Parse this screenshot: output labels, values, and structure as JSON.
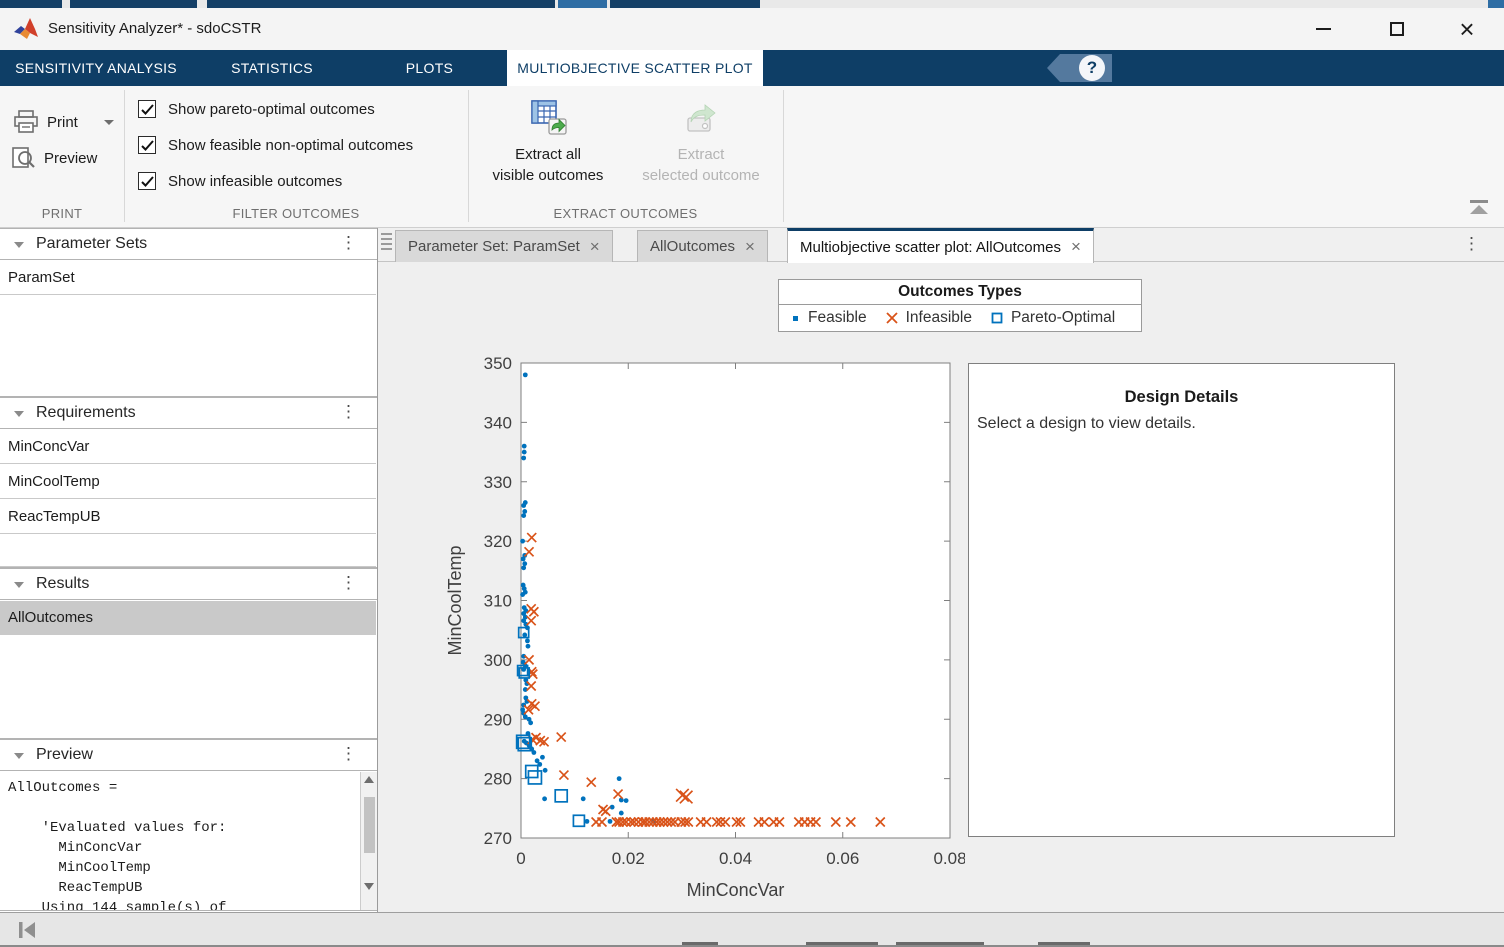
{
  "window": {
    "title": "Sensitivity Analyzer* - sdoCSTR"
  },
  "ribbon": {
    "tabs": [
      {
        "label": "SENSITIVITY ANALYSIS",
        "active": false
      },
      {
        "label": "STATISTICS",
        "active": false
      },
      {
        "label": "PLOTS",
        "active": false
      },
      {
        "label": "MULTIOBJECTIVE SCATTER PLOT",
        "active": true
      }
    ],
    "print_section": {
      "label": "PRINT",
      "print_button": "Print",
      "preview_button": "Preview"
    },
    "filter_section": {
      "label": "FILTER OUTCOMES",
      "checkboxes": [
        {
          "label": "Show pareto-optimal outcomes",
          "checked": true
        },
        {
          "label": "Show feasible non-optimal outcomes",
          "checked": true
        },
        {
          "label": "Show infeasible outcomes",
          "checked": true
        }
      ]
    },
    "extract_section": {
      "label": "EXTRACT OUTCOMES",
      "extract_all_line1": "Extract all",
      "extract_all_line2": "visible outcomes",
      "extract_selected_line1": "Extract",
      "extract_selected_line2": "selected outcome"
    }
  },
  "sidebar": {
    "parameter_sets": {
      "title": "Parameter Sets",
      "items": [
        "ParamSet"
      ]
    },
    "requirements": {
      "title": "Requirements",
      "items": [
        "MinConcVar",
        "MinCoolTemp",
        "ReacTempUB"
      ]
    },
    "results": {
      "title": "Results",
      "items": [
        "AllOutcomes"
      ],
      "selected": "AllOutcomes"
    },
    "preview": {
      "title": "Preview",
      "text": "AllOutcomes =\n\n    'Evaluated values for:\n      MinConcVar\n      MinCoolTemp\n      ReacTempUB\n    Using 144 sample(s) of"
    }
  },
  "doc_tabs": [
    {
      "label": "Parameter Set: ParamSet",
      "active": false
    },
    {
      "label": "AllOutcomes",
      "active": false
    },
    {
      "label": "Multiobjective scatter plot: AllOutcomes",
      "active": true
    }
  ],
  "design_details": {
    "title": "Design Details",
    "body": "Select a design to view details."
  },
  "chart_data": {
    "type": "scatter",
    "xlabel": "MinConcVar",
    "ylabel": "MinCoolTemp",
    "xlim": [
      0,
      0.08
    ],
    "ylim": [
      270,
      350
    ],
    "xticks": [
      0,
      0.02,
      0.04,
      0.06,
      0.08
    ],
    "xtick_labels": [
      "0",
      "0.02",
      "0.04",
      "0.06",
      "0.08"
    ],
    "yticks": [
      270,
      280,
      290,
      300,
      310,
      320,
      330,
      340,
      350
    ],
    "legend": {
      "title": "Outcomes Types",
      "position": "top",
      "entries": [
        {
          "label": "Feasible",
          "marker": "dot",
          "color": "#0072BD"
        },
        {
          "label": "Infeasible",
          "marker": "x",
          "color": "#D95319"
        },
        {
          "label": "Pareto-Optimal",
          "marker": "square-open",
          "color": "#0072BD"
        }
      ]
    },
    "series": [
      {
        "name": "Feasible",
        "marker": "dot",
        "color": "#0072BD",
        "points": [
          [
            0.0008,
            348
          ],
          [
            0.0006,
            336
          ],
          [
            0.0006,
            335
          ],
          [
            0.0005,
            334
          ],
          [
            0.0008,
            326.5
          ],
          [
            0.0005,
            326
          ],
          [
            0.0007,
            325
          ],
          [
            0.0005,
            324.3
          ],
          [
            0.0003,
            320
          ],
          [
            0.0007,
            317.6
          ],
          [
            0.0004,
            317
          ],
          [
            0.0007,
            316.2
          ],
          [
            0.0005,
            315.5
          ],
          [
            0.0004,
            312.6
          ],
          [
            0.0006,
            312
          ],
          [
            0.0008,
            311.4
          ],
          [
            0.0003,
            311
          ],
          [
            0.0006,
            308.8
          ],
          [
            0.0009,
            308.3
          ],
          [
            0.0005,
            307.8
          ],
          [
            0.0008,
            307.2
          ],
          [
            0.0005,
            306.6
          ],
          [
            0.0009,
            306
          ],
          [
            0.0012,
            305.4
          ],
          [
            0.0007,
            304.2
          ],
          [
            0.0012,
            303.2
          ],
          [
            0.0013,
            302.3
          ],
          [
            0.0005,
            300.6
          ],
          [
            0.0004,
            299.6
          ],
          [
            0.0008,
            299
          ],
          [
            0.0005,
            298.4
          ],
          [
            0.0009,
            296.6
          ],
          [
            0.0011,
            296
          ],
          [
            0.0008,
            295
          ],
          [
            0.0009,
            293.6
          ],
          [
            0.0011,
            293
          ],
          [
            0.0005,
            292.4
          ],
          [
            0.0003,
            291.6
          ],
          [
            0.0005,
            291
          ],
          [
            0.0008,
            290.4
          ],
          [
            0.0015,
            290
          ],
          [
            0.0018,
            289.4
          ],
          [
            0.0013,
            287.6
          ],
          [
            0.0006,
            286.3
          ],
          [
            0.001,
            286
          ],
          [
            0.0015,
            285.6
          ],
          [
            0.002,
            285
          ],
          [
            0.0024,
            284.4
          ],
          [
            0.004,
            283.6
          ],
          [
            0.003,
            283
          ],
          [
            0.0035,
            282.4
          ],
          [
            0.0045,
            281.4
          ],
          [
            0.0044,
            276.6
          ],
          [
            0.0116,
            276.6
          ],
          [
            0.0183,
            280
          ],
          [
            0.0187,
            276.4
          ],
          [
            0.0196,
            276.3
          ],
          [
            0.017,
            275.2
          ],
          [
            0.0187,
            274.2
          ],
          [
            0.0123,
            272.8
          ],
          [
            0.0166,
            272.8
          ],
          [
            0.0247,
            272.8
          ]
        ]
      },
      {
        "name": "Infeasible",
        "marker": "x",
        "color": "#D95319",
        "points": [
          [
            0.002,
            320.6
          ],
          [
            0.0015,
            318.2
          ],
          [
            0.0019,
            308.6
          ],
          [
            0.0024,
            308.1
          ],
          [
            0.0019,
            306.6
          ],
          [
            0.0015,
            300
          ],
          [
            0.002,
            298
          ],
          [
            0.0022,
            297.6
          ],
          [
            0.0019,
            295.6
          ],
          [
            0.002,
            292.6
          ],
          [
            0.0026,
            292.2
          ],
          [
            0.0014,
            291.6
          ],
          [
            0.0021,
            286.6
          ],
          [
            0.0028,
            286.9
          ],
          [
            0.0036,
            286.4
          ],
          [
            0.0043,
            286.2
          ],
          [
            0.0075,
            287
          ],
          [
            0.008,
            280.6
          ],
          [
            0.0131,
            279.4
          ],
          [
            0.0181,
            277.4
          ],
          [
            0.0153,
            274.8
          ],
          [
            0.0158,
            274.5
          ],
          [
            0.0301,
            277.2,
            1.4
          ],
          [
            0.0308,
            276.9,
            1.4
          ],
          [
            0.014,
            272.7
          ],
          [
            0.0151,
            272.7
          ],
          [
            0.0178,
            272.7
          ],
          [
            0.0183,
            272.7
          ],
          [
            0.019,
            272.7
          ],
          [
            0.0196,
            272.7
          ],
          [
            0.0205,
            272.7
          ],
          [
            0.0211,
            272.7
          ],
          [
            0.0219,
            272.7
          ],
          [
            0.0227,
            272.7
          ],
          [
            0.0232,
            272.7
          ],
          [
            0.0239,
            272.7
          ],
          [
            0.0246,
            272.7
          ],
          [
            0.0253,
            272.7
          ],
          [
            0.0259,
            272.7
          ],
          [
            0.0266,
            272.7
          ],
          [
            0.0273,
            272.7
          ],
          [
            0.028,
            272.7
          ],
          [
            0.0287,
            272.7
          ],
          [
            0.0299,
            272.7
          ],
          [
            0.0306,
            272.7
          ],
          [
            0.0312,
            272.7
          ],
          [
            0.0335,
            272.7
          ],
          [
            0.0346,
            272.7
          ],
          [
            0.0365,
            272.7
          ],
          [
            0.0372,
            272.7
          ],
          [
            0.0381,
            272.7
          ],
          [
            0.0402,
            272.7
          ],
          [
            0.0409,
            272.7
          ],
          [
            0.0443,
            272.7
          ],
          [
            0.0454,
            272.7
          ],
          [
            0.0471,
            272.7
          ],
          [
            0.0482,
            272.7
          ],
          [
            0.0518,
            272.7
          ],
          [
            0.0529,
            272.7
          ],
          [
            0.054,
            272.7
          ],
          [
            0.055,
            272.7
          ],
          [
            0.0587,
            272.7
          ],
          [
            0.0615,
            272.7
          ],
          [
            0.067,
            272.7
          ]
        ]
      },
      {
        "name": "Pareto-Optimal",
        "marker": "square-open",
        "color": "#0072BD",
        "points": [
          [
            0.0005,
            304.6
          ],
          [
            0.0003,
            298.2
          ],
          [
            0.0006,
            297.8
          ],
          [
            0.0004,
            286.2,
            1.3
          ],
          [
            0.0007,
            285.8,
            1.3
          ],
          [
            0.002,
            281.2,
            1.2
          ],
          [
            0.0026,
            280.2,
            1.3
          ],
          [
            0.0075,
            277.1,
            1.2
          ],
          [
            0.0108,
            272.9,
            1.1
          ]
        ]
      }
    ]
  },
  "colors": {
    "ribbon_navy": "#0E3E66",
    "matlab_blue": "#0072BD",
    "matlab_orange": "#D95319",
    "selected_row": "#C9C9C9"
  }
}
